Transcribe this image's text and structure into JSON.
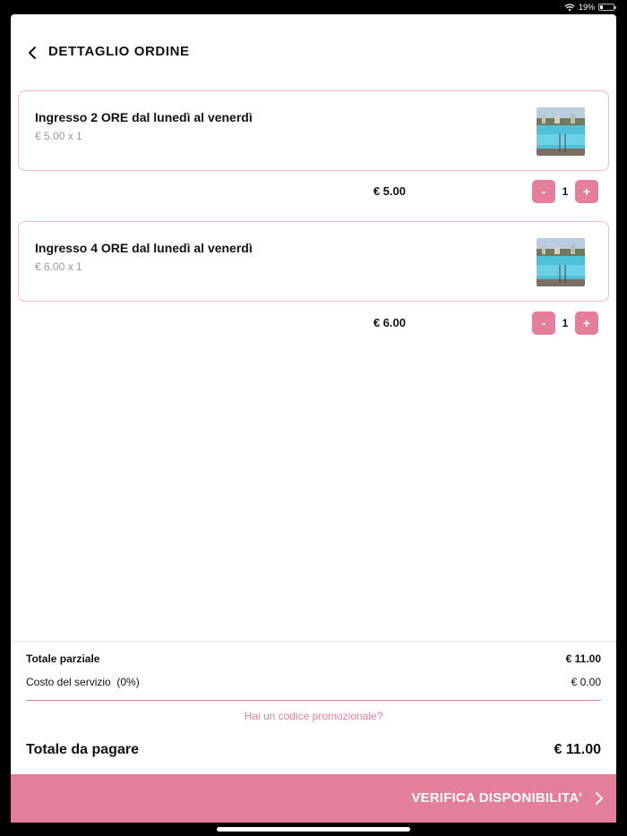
{
  "status_bar": {
    "battery_text": "19%",
    "battery_level": 0.19
  },
  "header": {
    "title": "DETTAGLIO ORDINE",
    "back_icon": "chevron-left-icon"
  },
  "order_items": [
    {
      "name": "Ingresso 2 ORE dal lunedì al venerdì",
      "unit_price_text": "€ 5.00 x 1",
      "total": "€ 5.00",
      "quantity": "1",
      "minus_label": "-",
      "plus_label": "+",
      "image": "pool-photo"
    },
    {
      "name": "Ingresso 4 ORE dal lunedì al venerdì",
      "unit_price_text": "€ 6.00 x 1",
      "total": "€ 6.00",
      "quantity": "1",
      "minus_label": "-",
      "plus_label": "+",
      "image": "pool-photo"
    }
  ],
  "summary": {
    "subtotal_label": "Totale parziale",
    "subtotal_value": "€ 11.00",
    "service_label": "Costo del servizio  (0%)",
    "service_value": "€ 0.00",
    "promo_link": "Hai un codice promozionale?",
    "total_label": "Totale da pagare",
    "total_value": "€ 11.00"
  },
  "cta": {
    "label": "VERIFICA DISPONIBILITA'",
    "icon": "chevron-right-icon"
  },
  "colors": {
    "accent": "#e47f9b",
    "card_border": "#f2b9c7",
    "text": "#111111",
    "muted": "#999999"
  }
}
